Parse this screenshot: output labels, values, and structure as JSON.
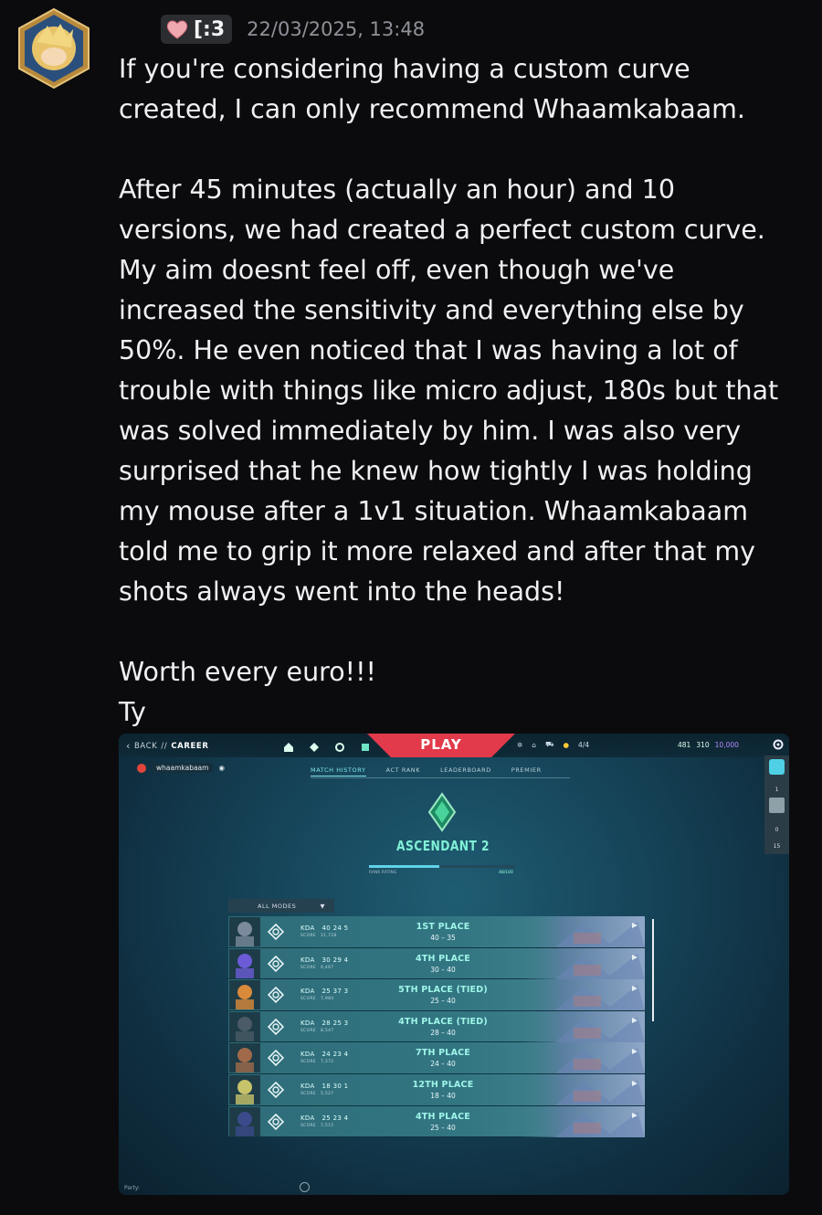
{
  "message": {
    "tag": "[:3",
    "timestamp": "22/03/2025, 13:48",
    "paragraphs": [
      "If you're considering having a custom curve created, I can only recommend Whaamkabaam.",
      "After 45 minutes (actually an hour) and 10 versions, we had created a perfect custom curve. My aim doesnt feel off, even though we've increased the sensitivity and everything else by 50%. He even noticed that I was having a lot of trouble with things like micro adjust, 180s but that was solved immediately by him. I was also very surprised that he knew how tightly I was holding my mouse after a 1v1 situation. Whaamkabaam told me to grip it more relaxed and after that my shots always went into the heads!",
      "Worth every euro!!!",
      "Ty"
    ]
  },
  "game": {
    "back": "BACK",
    "separator": "//",
    "section": "CAREER",
    "play_label": "PLAY",
    "party_count": "4/4",
    "currency": {
      "radianite": "481",
      "kingdom": "310",
      "vp": "10,000"
    },
    "player_name": "whaamkabaam",
    "tabs": [
      "MATCH HISTORY",
      "ACT RANK",
      "LEADERBOARD",
      "PREMIER"
    ],
    "rank_name": "ASCENDANT 2",
    "rank_rating_label": "RANK RATING",
    "rank_rating_value": "48/100",
    "rank_rating_fraction": 0.48,
    "sidebar_numbers": [
      "1",
      "0",
      "15"
    ],
    "modes_label": "ALL MODES",
    "party_label": "Party:",
    "kda_label": "KDA",
    "score_label": "SCORE",
    "matches": [
      {
        "kda": "40 24 5",
        "score": "11,728",
        "place": "1ST PLACE",
        "result": "40 – 35",
        "agent_color": "#7b8a9c"
      },
      {
        "kda": "30 29 4",
        "score": "9,467",
        "place": "4TH PLACE",
        "result": "30 – 40",
        "agent_color": "#6b5bd6"
      },
      {
        "kda": "25 37 3",
        "score": "7,984",
        "place": "5TH PLACE (TIED)",
        "result": "25 – 40",
        "agent_color": "#d98a3a"
      },
      {
        "kda": "28 25 3",
        "score": "8,547",
        "place": "4TH PLACE (TIED)",
        "result": "28 – 40",
        "agent_color": "#4a5a66"
      },
      {
        "kda": "24 23 4",
        "score": "7,372",
        "place": "7TH PLACE",
        "result": "24 – 40",
        "agent_color": "#a06a4a"
      },
      {
        "kda": "18 30 1",
        "score": "5,527",
        "place": "12TH PLACE",
        "result": "18 – 40",
        "agent_color": "#c7c36a"
      },
      {
        "kda": "25 23 4",
        "score": "7,515",
        "place": "4TH PLACE",
        "result": "25 – 40",
        "agent_color": "#3a4a8a"
      }
    ]
  }
}
